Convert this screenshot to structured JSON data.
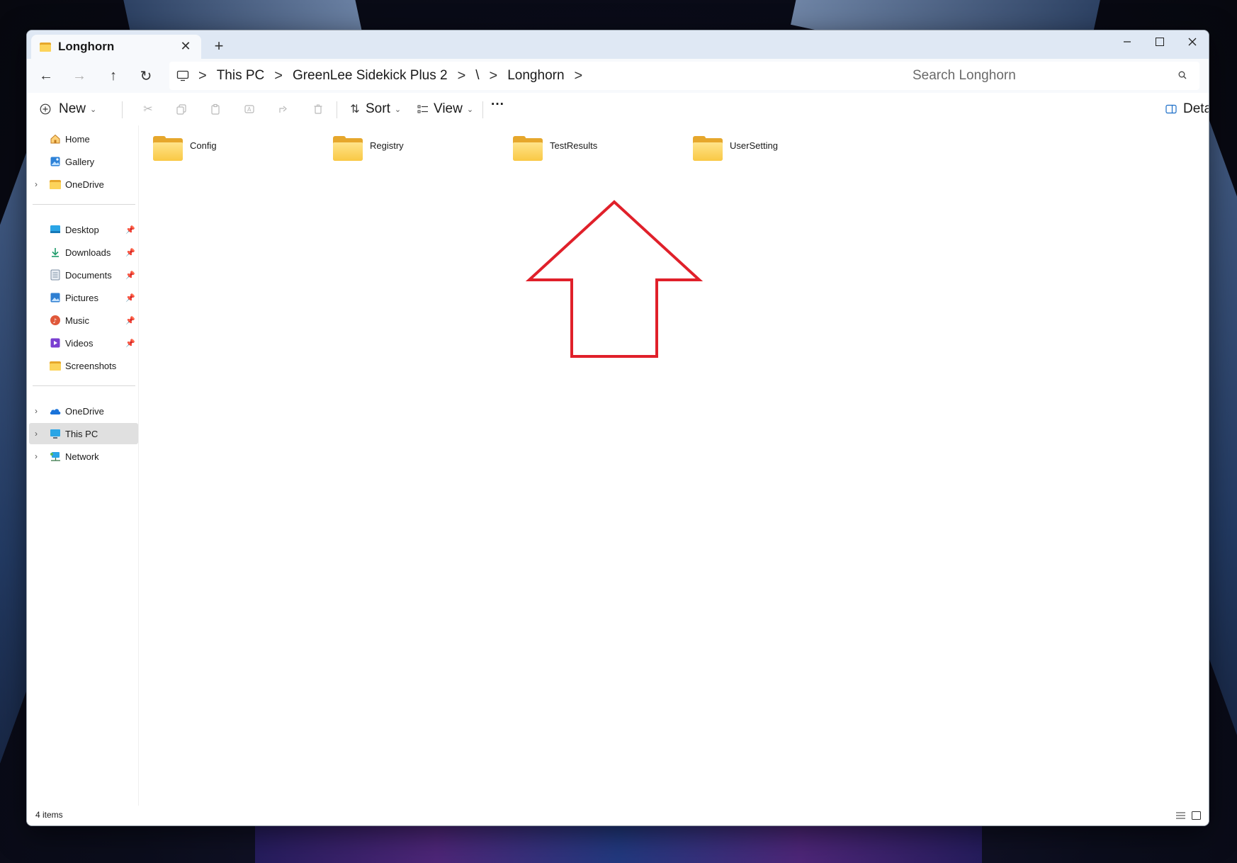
{
  "window": {
    "tab_title": "Longhorn",
    "tab_close": "✕",
    "new_tab": "+"
  },
  "nav": {
    "back": "←",
    "forward": "→",
    "up": "↑",
    "refresh": "↻"
  },
  "address": {
    "segments": [
      "This PC",
      "GreenLee Sidekick Plus 2",
      "\\",
      "Longhorn"
    ],
    "separator": ">"
  },
  "search": {
    "placeholder": "Search Longhorn"
  },
  "toolbar": {
    "new_label": "New",
    "sort_label": "Sort",
    "view_label": "View",
    "more_label": "···",
    "details_label": "Details"
  },
  "sidebar": {
    "quick": [
      {
        "label": "Home",
        "icon": "home-icon"
      },
      {
        "label": "Gallery",
        "icon": "gallery-icon"
      },
      {
        "label": "OneDrive",
        "icon": "folder-icon",
        "expandable": true
      }
    ],
    "pinned": [
      {
        "label": "Desktop",
        "icon": "desktop-icon",
        "pinned": true
      },
      {
        "label": "Downloads",
        "icon": "download-icon",
        "pinned": true
      },
      {
        "label": "Documents",
        "icon": "documents-icon",
        "pinned": true
      },
      {
        "label": "Pictures",
        "icon": "pictures-icon",
        "pinned": true
      },
      {
        "label": "Music",
        "icon": "music-icon",
        "pinned": true
      },
      {
        "label": "Videos",
        "icon": "videos-icon",
        "pinned": true
      },
      {
        "label": "Screenshots",
        "icon": "folder-icon",
        "pinned": false
      }
    ],
    "locations": [
      {
        "label": "OneDrive",
        "icon": "cloud-icon",
        "expandable": true
      },
      {
        "label": "This PC",
        "icon": "pc-icon",
        "expandable": true,
        "selected": true
      },
      {
        "label": "Network",
        "icon": "network-icon",
        "expandable": true
      }
    ]
  },
  "folders": [
    {
      "name": "Config"
    },
    {
      "name": "Registry"
    },
    {
      "name": "TestResults"
    },
    {
      "name": "UserSetting"
    }
  ],
  "status": {
    "item_count": "4 items"
  },
  "colors": {
    "annotation": "#e0202a",
    "selection": "#e0e0e0",
    "folder": "#f9c844"
  }
}
